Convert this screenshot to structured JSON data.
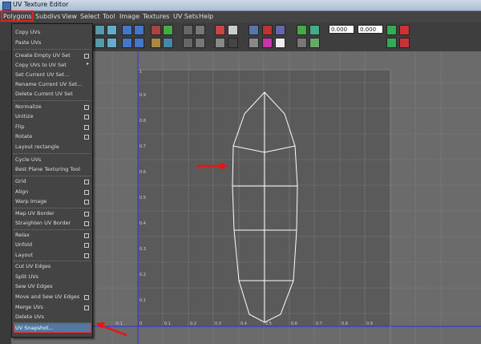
{
  "window": {
    "title": "UV Texture Editor"
  },
  "menubar": {
    "items": [
      "Polygons",
      "Subdivs",
      "View",
      "Select",
      "Tool",
      "Image",
      "Textures",
      "UV Sets",
      "Help"
    ]
  },
  "toolbar": {
    "field_1": "0.000",
    "field_2": "0.000"
  },
  "menu": {
    "items": [
      {
        "label": "Copy UVs",
        "option": false
      },
      {
        "label": "Paste UVs",
        "option": false
      },
      {
        "label": "Create Empty UV Set",
        "option": true
      },
      {
        "label": "Copy UVs to UV Set",
        "submenu": true
      },
      {
        "label": "Set Current UV Set...",
        "option": false
      },
      {
        "label": "Rename Current UV Set...",
        "option": false
      },
      {
        "label": "Delete Current UV Set",
        "option": false
      },
      {
        "label": "Normalize",
        "option": true
      },
      {
        "label": "Unitize",
        "option": true
      },
      {
        "label": "Flip",
        "option": true
      },
      {
        "label": "Rotate",
        "option": true
      },
      {
        "label": "Layout rectangle",
        "option": false
      },
      {
        "label": "Cycle UVs",
        "option": false
      },
      {
        "label": "Best Plane Texturing Tool",
        "option": false
      },
      {
        "label": "Grid",
        "option": true
      },
      {
        "label": "Align",
        "option": true
      },
      {
        "label": "Warp Image",
        "option": true
      },
      {
        "label": "Map UV Border",
        "option": true
      },
      {
        "label": "Straighten UV Border",
        "option": true
      },
      {
        "label": "Relax",
        "option": true
      },
      {
        "label": "Unfold",
        "option": true
      },
      {
        "label": "Layout",
        "option": true
      },
      {
        "label": "Cut UV Edges",
        "option": false
      },
      {
        "label": "Split UVs",
        "option": false
      },
      {
        "label": "Sew UV Edges",
        "option": false
      },
      {
        "label": "Move and Sew UV Edges",
        "option": true
      },
      {
        "label": "Merge UVs",
        "option": true
      },
      {
        "label": "Delete UVs",
        "option": false
      },
      {
        "label": "UV Snapshot...",
        "option": false,
        "highlighted": true
      }
    ]
  },
  "axis_ticks": {
    "x": [
      "-0.1",
      "0",
      "0.1",
      "0.2",
      "0.3",
      "0.4",
      "0.5",
      "0.6",
      "0.7",
      "0.8",
      "0.9"
    ],
    "y": [
      "1",
      "0.9",
      "0.8",
      "0.7",
      "0.6",
      "0.5",
      "0.4",
      "0.3",
      "0.2",
      "0.1"
    ]
  },
  "colors": {
    "highlight": "#5278a6",
    "annotation": "#e11111",
    "uv_wire": "#ffffff"
  }
}
